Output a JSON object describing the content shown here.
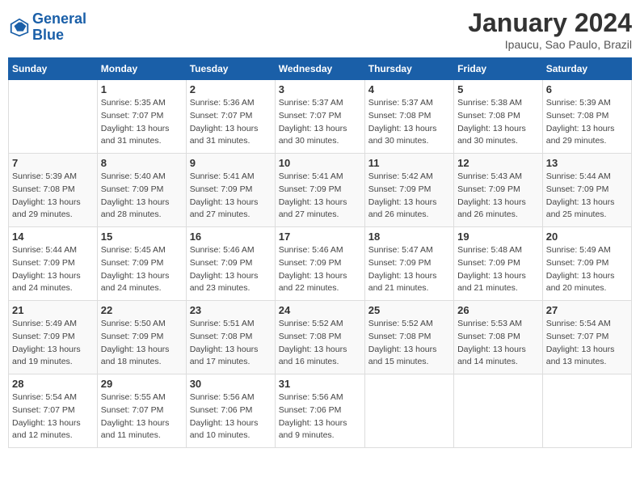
{
  "header": {
    "logo_line1": "General",
    "logo_line2": "Blue",
    "month": "January 2024",
    "location": "Ipaucu, Sao Paulo, Brazil"
  },
  "columns": [
    "Sunday",
    "Monday",
    "Tuesday",
    "Wednesday",
    "Thursday",
    "Friday",
    "Saturday"
  ],
  "weeks": [
    [
      {
        "day": "",
        "sunrise": "",
        "sunset": "",
        "daylight": ""
      },
      {
        "day": "1",
        "sunrise": "Sunrise: 5:35 AM",
        "sunset": "Sunset: 7:07 PM",
        "daylight": "Daylight: 13 hours and 31 minutes."
      },
      {
        "day": "2",
        "sunrise": "Sunrise: 5:36 AM",
        "sunset": "Sunset: 7:07 PM",
        "daylight": "Daylight: 13 hours and 31 minutes."
      },
      {
        "day": "3",
        "sunrise": "Sunrise: 5:37 AM",
        "sunset": "Sunset: 7:07 PM",
        "daylight": "Daylight: 13 hours and 30 minutes."
      },
      {
        "day": "4",
        "sunrise": "Sunrise: 5:37 AM",
        "sunset": "Sunset: 7:08 PM",
        "daylight": "Daylight: 13 hours and 30 minutes."
      },
      {
        "day": "5",
        "sunrise": "Sunrise: 5:38 AM",
        "sunset": "Sunset: 7:08 PM",
        "daylight": "Daylight: 13 hours and 30 minutes."
      },
      {
        "day": "6",
        "sunrise": "Sunrise: 5:39 AM",
        "sunset": "Sunset: 7:08 PM",
        "daylight": "Daylight: 13 hours and 29 minutes."
      }
    ],
    [
      {
        "day": "7",
        "sunrise": "Sunrise: 5:39 AM",
        "sunset": "Sunset: 7:08 PM",
        "daylight": "Daylight: 13 hours and 29 minutes."
      },
      {
        "day": "8",
        "sunrise": "Sunrise: 5:40 AM",
        "sunset": "Sunset: 7:09 PM",
        "daylight": "Daylight: 13 hours and 28 minutes."
      },
      {
        "day": "9",
        "sunrise": "Sunrise: 5:41 AM",
        "sunset": "Sunset: 7:09 PM",
        "daylight": "Daylight: 13 hours and 27 minutes."
      },
      {
        "day": "10",
        "sunrise": "Sunrise: 5:41 AM",
        "sunset": "Sunset: 7:09 PM",
        "daylight": "Daylight: 13 hours and 27 minutes."
      },
      {
        "day": "11",
        "sunrise": "Sunrise: 5:42 AM",
        "sunset": "Sunset: 7:09 PM",
        "daylight": "Daylight: 13 hours and 26 minutes."
      },
      {
        "day": "12",
        "sunrise": "Sunrise: 5:43 AM",
        "sunset": "Sunset: 7:09 PM",
        "daylight": "Daylight: 13 hours and 26 minutes."
      },
      {
        "day": "13",
        "sunrise": "Sunrise: 5:44 AM",
        "sunset": "Sunset: 7:09 PM",
        "daylight": "Daylight: 13 hours and 25 minutes."
      }
    ],
    [
      {
        "day": "14",
        "sunrise": "Sunrise: 5:44 AM",
        "sunset": "Sunset: 7:09 PM",
        "daylight": "Daylight: 13 hours and 24 minutes."
      },
      {
        "day": "15",
        "sunrise": "Sunrise: 5:45 AM",
        "sunset": "Sunset: 7:09 PM",
        "daylight": "Daylight: 13 hours and 24 minutes."
      },
      {
        "day": "16",
        "sunrise": "Sunrise: 5:46 AM",
        "sunset": "Sunset: 7:09 PM",
        "daylight": "Daylight: 13 hours and 23 minutes."
      },
      {
        "day": "17",
        "sunrise": "Sunrise: 5:46 AM",
        "sunset": "Sunset: 7:09 PM",
        "daylight": "Daylight: 13 hours and 22 minutes."
      },
      {
        "day": "18",
        "sunrise": "Sunrise: 5:47 AM",
        "sunset": "Sunset: 7:09 PM",
        "daylight": "Daylight: 13 hours and 21 minutes."
      },
      {
        "day": "19",
        "sunrise": "Sunrise: 5:48 AM",
        "sunset": "Sunset: 7:09 PM",
        "daylight": "Daylight: 13 hours and 21 minutes."
      },
      {
        "day": "20",
        "sunrise": "Sunrise: 5:49 AM",
        "sunset": "Sunset: 7:09 PM",
        "daylight": "Daylight: 13 hours and 20 minutes."
      }
    ],
    [
      {
        "day": "21",
        "sunrise": "Sunrise: 5:49 AM",
        "sunset": "Sunset: 7:09 PM",
        "daylight": "Daylight: 13 hours and 19 minutes."
      },
      {
        "day": "22",
        "sunrise": "Sunrise: 5:50 AM",
        "sunset": "Sunset: 7:09 PM",
        "daylight": "Daylight: 13 hours and 18 minutes."
      },
      {
        "day": "23",
        "sunrise": "Sunrise: 5:51 AM",
        "sunset": "Sunset: 7:08 PM",
        "daylight": "Daylight: 13 hours and 17 minutes."
      },
      {
        "day": "24",
        "sunrise": "Sunrise: 5:52 AM",
        "sunset": "Sunset: 7:08 PM",
        "daylight": "Daylight: 13 hours and 16 minutes."
      },
      {
        "day": "25",
        "sunrise": "Sunrise: 5:52 AM",
        "sunset": "Sunset: 7:08 PM",
        "daylight": "Daylight: 13 hours and 15 minutes."
      },
      {
        "day": "26",
        "sunrise": "Sunrise: 5:53 AM",
        "sunset": "Sunset: 7:08 PM",
        "daylight": "Daylight: 13 hours and 14 minutes."
      },
      {
        "day": "27",
        "sunrise": "Sunrise: 5:54 AM",
        "sunset": "Sunset: 7:07 PM",
        "daylight": "Daylight: 13 hours and 13 minutes."
      }
    ],
    [
      {
        "day": "28",
        "sunrise": "Sunrise: 5:54 AM",
        "sunset": "Sunset: 7:07 PM",
        "daylight": "Daylight: 13 hours and 12 minutes."
      },
      {
        "day": "29",
        "sunrise": "Sunrise: 5:55 AM",
        "sunset": "Sunset: 7:07 PM",
        "daylight": "Daylight: 13 hours and 11 minutes."
      },
      {
        "day": "30",
        "sunrise": "Sunrise: 5:56 AM",
        "sunset": "Sunset: 7:06 PM",
        "daylight": "Daylight: 13 hours and 10 minutes."
      },
      {
        "day": "31",
        "sunrise": "Sunrise: 5:56 AM",
        "sunset": "Sunset: 7:06 PM",
        "daylight": "Daylight: 13 hours and 9 minutes."
      },
      {
        "day": "",
        "sunrise": "",
        "sunset": "",
        "daylight": ""
      },
      {
        "day": "",
        "sunrise": "",
        "sunset": "",
        "daylight": ""
      },
      {
        "day": "",
        "sunrise": "",
        "sunset": "",
        "daylight": ""
      }
    ]
  ]
}
